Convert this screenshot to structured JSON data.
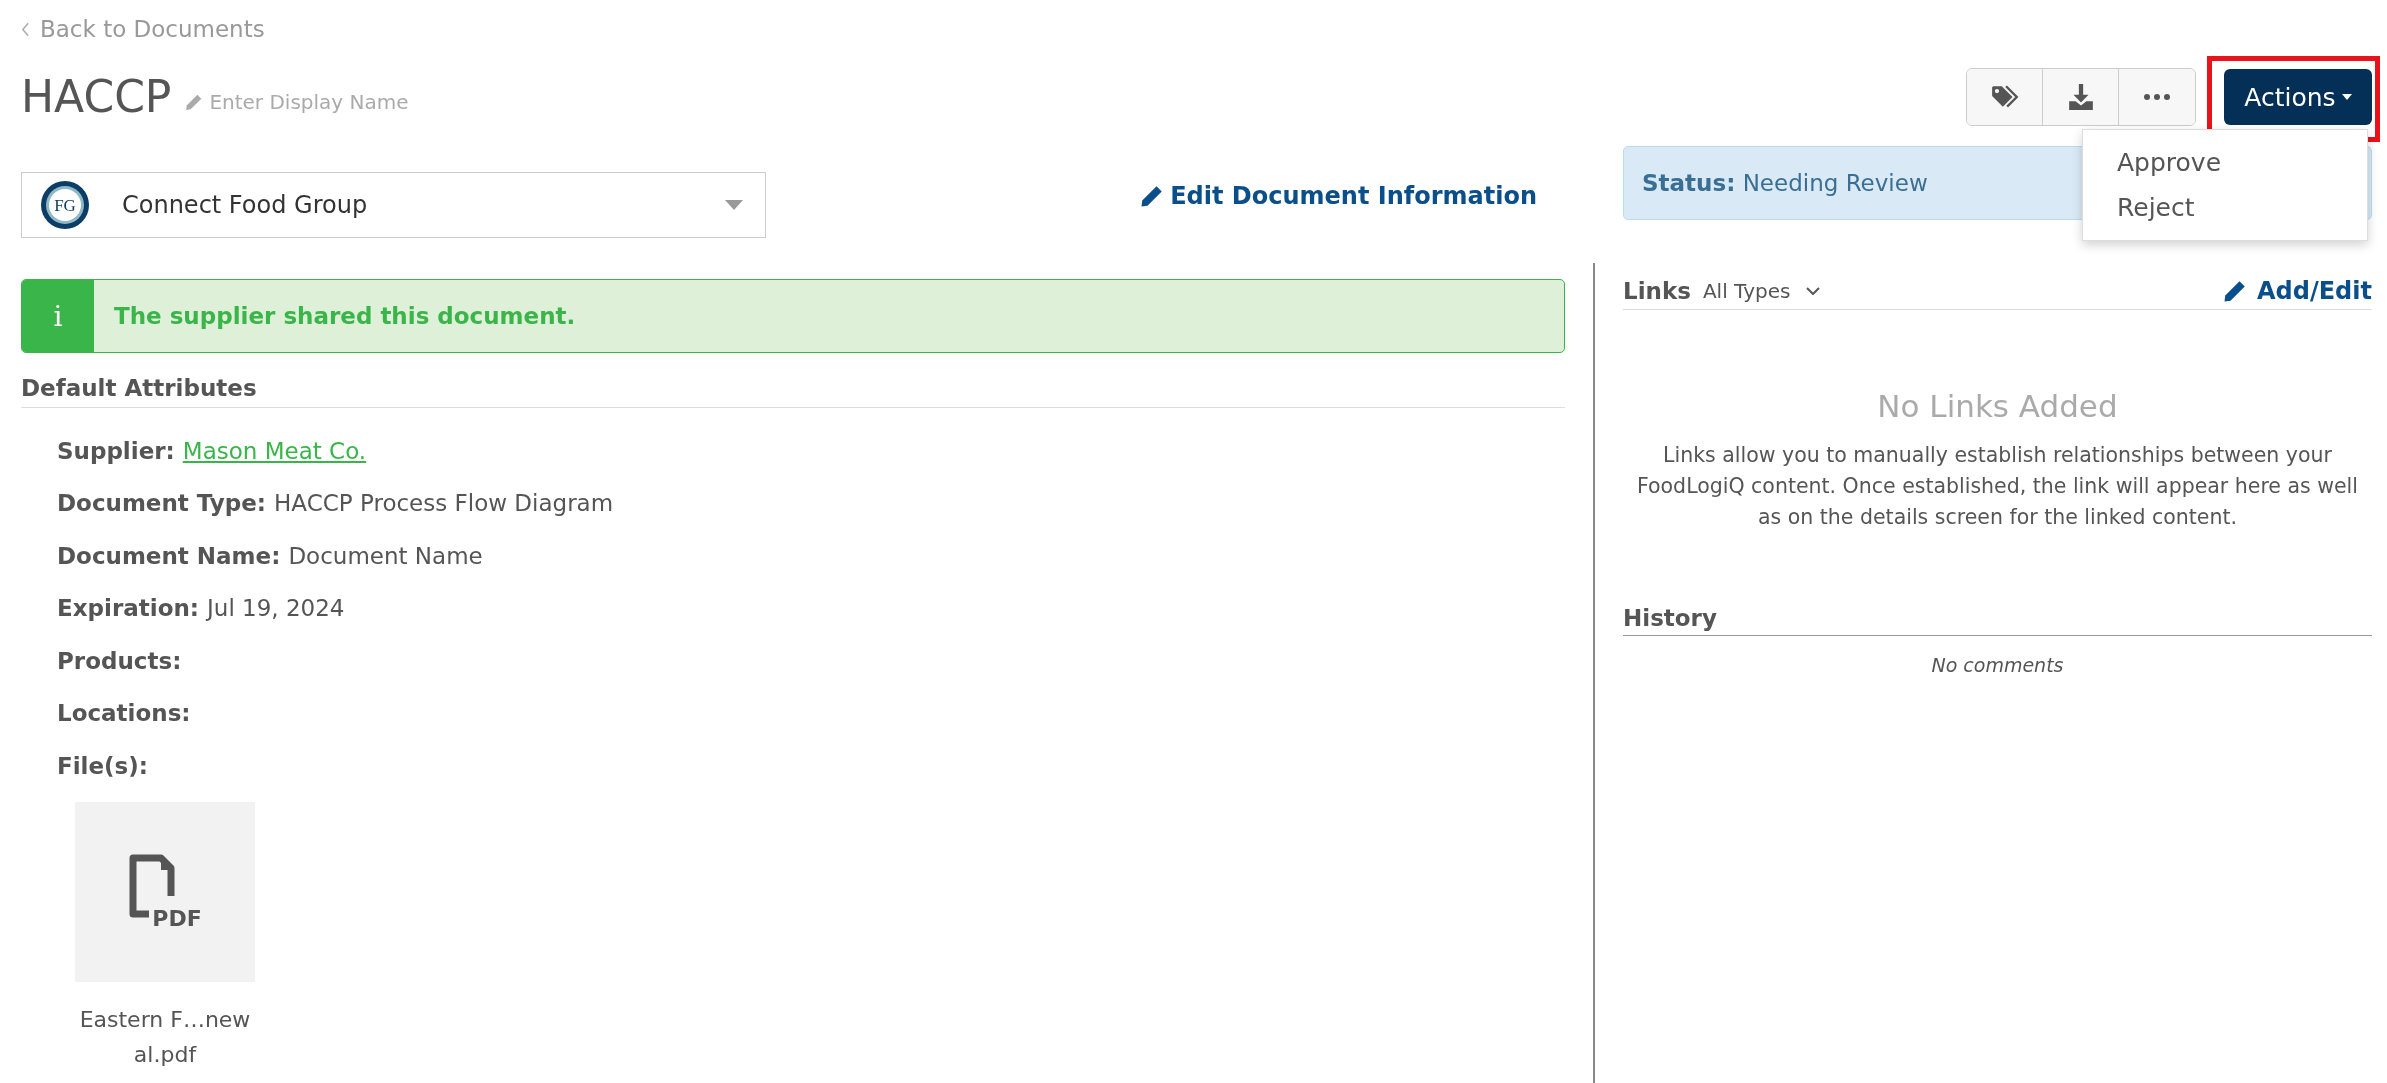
{
  "back_link": "Back to Documents",
  "title": "HACCP",
  "display_name": {
    "placeholder": "Enter Display Name"
  },
  "actions": {
    "label": "Actions",
    "highlighted": true,
    "expanded": true,
    "menu": [
      "Approve",
      "Reject"
    ]
  },
  "organization": {
    "name": "Connect Food Group",
    "logo_text": "FG"
  },
  "edit_link": "Edit Document Information",
  "status": {
    "label": "Status:",
    "value": "Needing Review"
  },
  "notice": {
    "icon": "i",
    "text": "The supplier shared this document."
  },
  "attributes": {
    "title": "Default Attributes",
    "rows": [
      {
        "label": "Supplier:",
        "value": "Mason Meat Co.",
        "kind": "link"
      },
      {
        "label": "Document Type:",
        "value": "HACCP Process Flow Diagram",
        "kind": "text"
      },
      {
        "label": "Document Name:",
        "value": "Document Name",
        "kind": "text"
      },
      {
        "label": "Expiration:",
        "value": "Jul 19, 2024",
        "kind": "text"
      },
      {
        "label": "Products:",
        "kind": "text"
      },
      {
        "label": "Locations:",
        "kind": "text"
      }
    ]
  },
  "files": {
    "label": "File(s):",
    "items": [
      {
        "type_label": "PDF",
        "name_lines": [
          "Eastern F…new",
          "al.pdf"
        ]
      }
    ]
  },
  "links": {
    "title": "Links",
    "filter": "All Types",
    "add_edit": "Add/Edit",
    "empty_title": "No Links Added",
    "empty_text": "Links allow you to manually establish relationships between your FoodLogiQ content. Once established, the link will appear here as well as on the details screen for the linked content."
  },
  "history": {
    "title": "History",
    "empty": "No comments"
  }
}
